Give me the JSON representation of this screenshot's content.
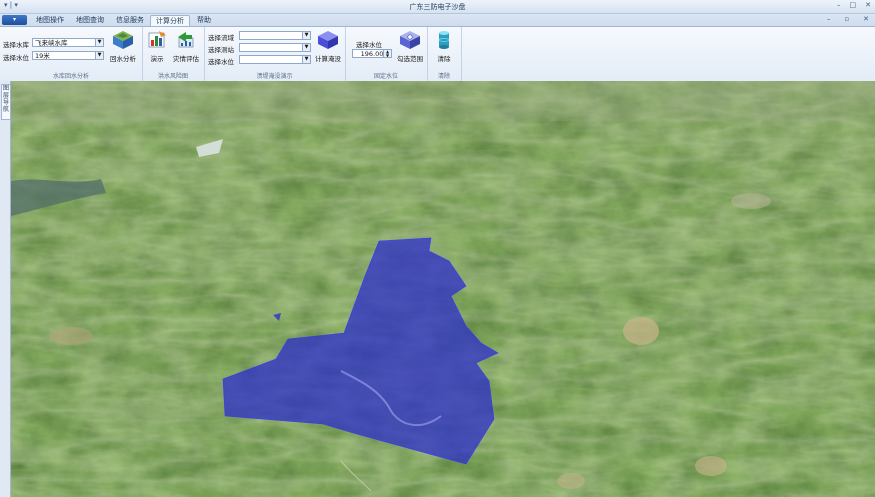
{
  "window": {
    "title": "广东三防电子沙盘",
    "qat": "▾ | ▾",
    "controls": [
      "–",
      "□",
      "✕"
    ]
  },
  "app_button_label": "▾",
  "tabs": [
    {
      "label": "地图操作",
      "active": false
    },
    {
      "label": "地图查询",
      "active": false
    },
    {
      "label": "信息服务",
      "active": false
    },
    {
      "label": "计算分析",
      "active": true
    },
    {
      "label": "帮助",
      "active": false
    }
  ],
  "tab_right_icons": [
    "–",
    "▫",
    "✕"
  ],
  "ribbon": {
    "group_backwater": {
      "label": "水库回水分析",
      "reservoir_label": "选择水库",
      "reservoir_value": "飞来峡水库",
      "level_label": "选择水位",
      "level_value": "19米",
      "button": "回水分析"
    },
    "group_flood_risk": {
      "label": "洪水风险图",
      "demo_button": "演示",
      "assess_button": "灾情评估"
    },
    "group_inundation": {
      "label": "溃堤淹没演示",
      "basin_label": "选择流域",
      "station_label": "选择测站",
      "level_label": "选择水位",
      "basin_value": "",
      "station_value": "",
      "level_value": "",
      "button": "计算淹没"
    },
    "group_fixed_level": {
      "label": "固定水位",
      "level_label": "选择水位",
      "level_value": "196.00",
      "button": "勾选范围"
    },
    "group_clear": {
      "label": "清除",
      "button": "清除"
    }
  },
  "side_panel": {
    "label": "图层导航"
  },
  "colors": {
    "inundation_fill": "#2a2ad0",
    "ribbon_accent": "#1d4f9a"
  }
}
